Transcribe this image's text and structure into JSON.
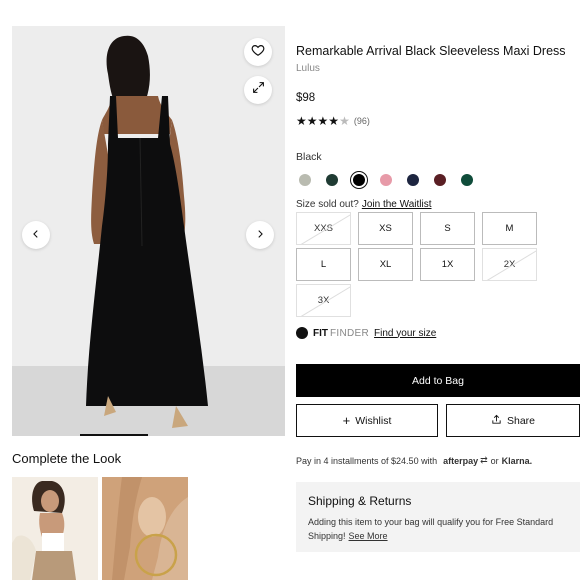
{
  "product": {
    "title": "Remarkable Arrival Black Sleeveless Maxi Dress",
    "brand": "Lulus",
    "price": "$98",
    "rating": 4.5,
    "review_count": "(96)"
  },
  "colors": {
    "selected_label": "Black",
    "swatches": [
      {
        "name": "sage",
        "hex": "#b9bbb0"
      },
      {
        "name": "dark-green",
        "hex": "#1f3b33"
      },
      {
        "name": "black",
        "hex": "#000000",
        "selected": true
      },
      {
        "name": "pink",
        "hex": "#e79aa8"
      },
      {
        "name": "navy",
        "hex": "#1d2540"
      },
      {
        "name": "burgundy",
        "hex": "#5a1f24"
      },
      {
        "name": "emerald",
        "hex": "#0f4c3a"
      }
    ]
  },
  "sizes": {
    "note": "Size sold out?",
    "waitlist_link": "Join the Waitlist",
    "options": [
      {
        "label": "XXS",
        "sold_out": true
      },
      {
        "label": "XS",
        "sold_out": false
      },
      {
        "label": "S",
        "sold_out": false
      },
      {
        "label": "M",
        "sold_out": false
      },
      {
        "label": "L",
        "sold_out": false
      },
      {
        "label": "XL",
        "sold_out": false
      },
      {
        "label": "1X",
        "sold_out": false
      },
      {
        "label": "2X",
        "sold_out": true
      },
      {
        "label": "3X",
        "sold_out": true
      }
    ]
  },
  "fit_finder": {
    "fit": "FIT",
    "finder": "FINDER",
    "link": "Find your size"
  },
  "actions": {
    "add_to_bag": "Add to Bag",
    "wishlist": "Wishlist",
    "share": "Share"
  },
  "installments": {
    "text": "Pay in 4 installments of $24.50 with",
    "afterpay": "afterpay",
    "or": "or",
    "klarna": "Klarna."
  },
  "shipping": {
    "heading": "Shipping & Returns",
    "body": "Adding this item to your bag will qualify you for Free Standard Shipping!",
    "link": "See More"
  },
  "complete_the_look": {
    "heading": "Complete the Look"
  },
  "icons": {
    "favorite": "heart-icon",
    "expand": "expand-icon",
    "prev": "chevron-left-icon",
    "next": "chevron-right-icon",
    "share": "share-icon",
    "wishlist": "plus-icon"
  }
}
